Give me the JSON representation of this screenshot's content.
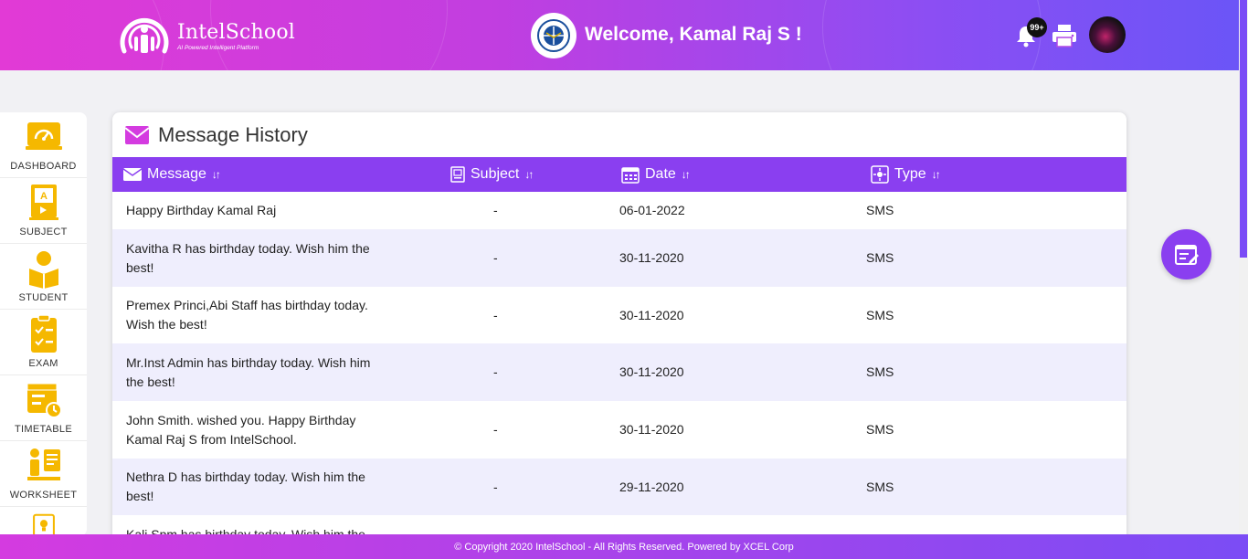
{
  "header": {
    "brand_name": "IntelSchool",
    "brand_tagline": "AI Powered Intelligent Platform",
    "welcome": "Welcome, Kamal Raj S !",
    "notification_count": "99+"
  },
  "sidebar": {
    "items": [
      {
        "label": "DASHBOARD",
        "icon": "dashboard-icon"
      },
      {
        "label": "SUBJECT",
        "icon": "subject-icon"
      },
      {
        "label": "STUDENT",
        "icon": "student-icon"
      },
      {
        "label": "EXAM",
        "icon": "exam-icon"
      },
      {
        "label": "TIMETABLE",
        "icon": "timetable-icon"
      },
      {
        "label": "WORKSHEET",
        "icon": "worksheet-icon"
      }
    ]
  },
  "panel": {
    "title": "Message History",
    "columns": [
      "Message",
      "Subject",
      "Date",
      "Type"
    ],
    "rows": [
      {
        "message": "Happy Birthday Kamal Raj",
        "subject": "-",
        "date": "06-01-2022",
        "type": "SMS"
      },
      {
        "message": "Kavitha R has birthday today. Wish him the best!",
        "subject": "-",
        "date": "30-11-2020",
        "type": "SMS"
      },
      {
        "message": "Premex Princi,Abi Staff has birthday today. Wish the best!",
        "subject": "-",
        "date": "30-11-2020",
        "type": "SMS"
      },
      {
        "message": "Mr.Inst Admin has birthday today. Wish him the best!",
        "subject": "-",
        "date": "30-11-2020",
        "type": "SMS"
      },
      {
        "message": "John Smith. wished you. Happy Birthday Kamal Raj S from IntelSchool.",
        "subject": "-",
        "date": "30-11-2020",
        "type": "SMS"
      },
      {
        "message": "Nethra D has birthday today. Wish him the best!",
        "subject": "-",
        "date": "29-11-2020",
        "type": "SMS"
      },
      {
        "message": "Kali Spm has birthday today. Wish him the best!",
        "subject": "-",
        "date": "",
        "type": ""
      }
    ]
  },
  "footer": {
    "text": "© Copyright 2020 IntelSchool - All Rights Reserved. Powered by XCEL Corp"
  },
  "colors": {
    "accent": "#8a3ff0",
    "header_start": "#e23ad6",
    "header_end": "#6b55f7",
    "icon_yellow": "#f5b800",
    "row_alt": "#efeefd"
  }
}
